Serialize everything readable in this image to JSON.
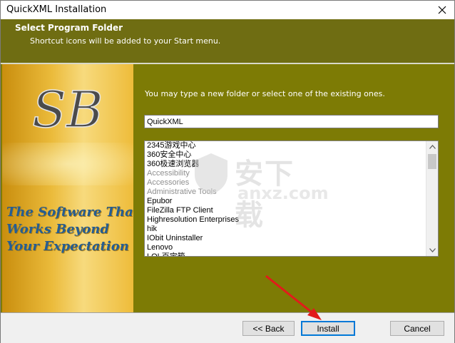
{
  "window": {
    "title": "QuickXML Installation"
  },
  "header": {
    "title": "Select Program Folder",
    "subtitle": "Shortcut icons will be added to your Start menu."
  },
  "side_panel": {
    "logo": "SB",
    "slogan": "The Software That\nWorks Beyond\nYour Expectation"
  },
  "main": {
    "instruction": "You may type a new folder or select one of the existing ones.",
    "folder_value": "QuickXML",
    "folders": [
      "2345游戏中心",
      "360安全中心",
      "360极速浏览器",
      "Accessibility",
      "Accessories",
      "Administrative Tools",
      "Epubor",
      "FileZilla FTP Client",
      "Highresolution Enterprises",
      "hik",
      "IObit Uninstaller",
      "Lenovo",
      "LOL百宝箱"
    ]
  },
  "watermark": {
    "text": "安下载",
    "sub": "anxz.com"
  },
  "footer": {
    "back_label": "<< Back",
    "install_label": "Install",
    "cancel_label": "Cancel"
  },
  "colors": {
    "header_bg": "#6f6d12",
    "content_bg": "#7d7b05",
    "arrow": "#e21b1b",
    "focus": "#0078d7"
  }
}
